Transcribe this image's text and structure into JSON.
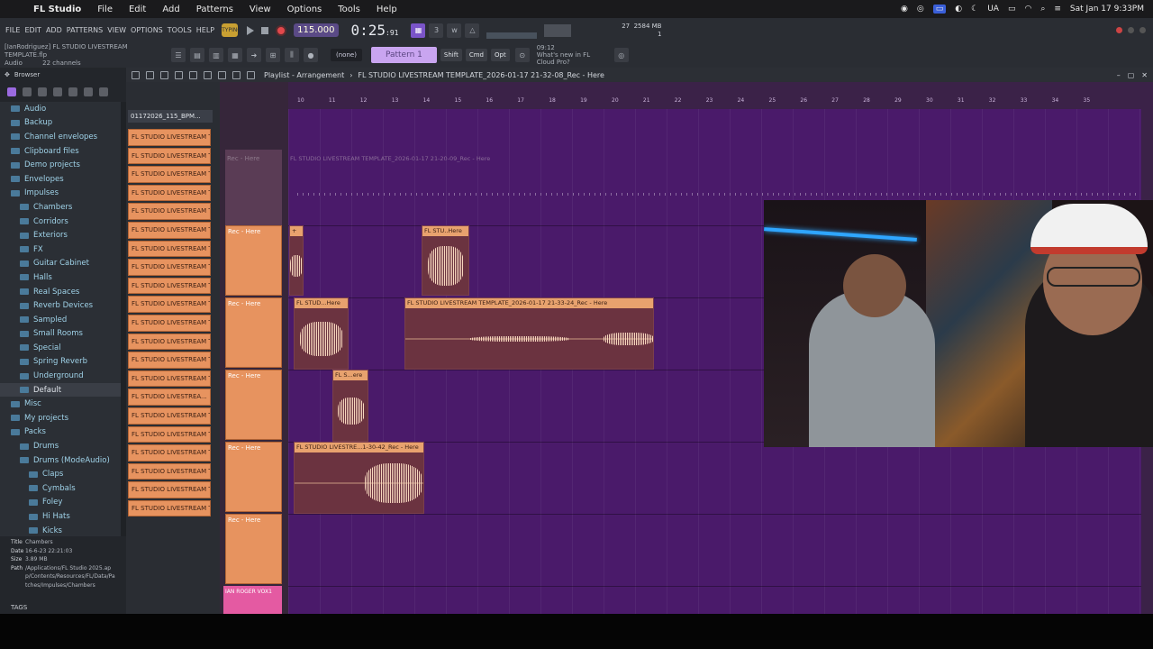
{
  "menubar": {
    "app": "FL Studio",
    "items": [
      "File",
      "Edit",
      "Add",
      "Patterns",
      "View",
      "Options",
      "Tools",
      "Help"
    ],
    "status": [
      "UA"
    ],
    "datetime": "Sat Jan 17  9:33PM"
  },
  "toolbar": {
    "fl_menu": [
      "FILE",
      "EDIT",
      "ADD",
      "PATTERNS",
      "VIEW",
      "OPTIONS",
      "TOOLS",
      "HELP"
    ],
    "hint": "TYPING",
    "tempo": "115.000",
    "time_main": "0:25",
    "time_sub": ":91",
    "cpu_top": "27",
    "mem": "2584 MB",
    "voices": "1"
  },
  "toolbar2": {
    "path_line1": "[IanRodriguez] FL STUDIO LIVESTREAM TEMPLATE.flp",
    "path_line2": "Audio",
    "channels": "22 channels",
    "snap": "(none)",
    "pattern": "Pattern 1",
    "keys": [
      "Shift",
      "Cmd",
      "Opt"
    ],
    "news_time": "09:12",
    "news_text": "What's new in FL Cloud Pro?"
  },
  "browser": {
    "title": "Browser",
    "items": [
      {
        "label": "Audio",
        "level": 0
      },
      {
        "label": "Backup",
        "level": 0
      },
      {
        "label": "Channel envelopes",
        "level": 0
      },
      {
        "label": "Clipboard files",
        "level": 0
      },
      {
        "label": "Demo projects",
        "level": 0
      },
      {
        "label": "Envelopes",
        "level": 0
      },
      {
        "label": "Impulses",
        "level": 0
      },
      {
        "label": "Chambers",
        "level": 1
      },
      {
        "label": "Corridors",
        "level": 1
      },
      {
        "label": "Exteriors",
        "level": 1
      },
      {
        "label": "FX",
        "level": 1
      },
      {
        "label": "Guitar Cabinet",
        "level": 1
      },
      {
        "label": "Halls",
        "level": 1
      },
      {
        "label": "Real Spaces",
        "level": 1
      },
      {
        "label": "Reverb Devices",
        "level": 1
      },
      {
        "label": "Sampled",
        "level": 1
      },
      {
        "label": "Small Rooms",
        "level": 1
      },
      {
        "label": "Special",
        "level": 1
      },
      {
        "label": "Spring Reverb",
        "level": 1
      },
      {
        "label": "Underground",
        "level": 1
      },
      {
        "label": "Default",
        "level": 1,
        "selected": true
      },
      {
        "label": "Misc",
        "level": 0
      },
      {
        "label": "My projects",
        "level": 0
      },
      {
        "label": "Packs",
        "level": 0
      },
      {
        "label": "Drums",
        "level": 1
      },
      {
        "label": "Drums (ModeAudio)",
        "level": 1
      },
      {
        "label": "Claps",
        "level": 2
      },
      {
        "label": "Cymbals",
        "level": 2
      },
      {
        "label": "Foley",
        "level": 2
      },
      {
        "label": "Hi Hats",
        "level": 2
      },
      {
        "label": "Kicks",
        "level": 2
      }
    ],
    "fileinfo": {
      "title_k": "Title",
      "title_v": "Chambers",
      "date_k": "Date",
      "date_v": "16-6-23 22:21:03",
      "size_k": "Size",
      "size_v": "3.89 MB",
      "path_k": "Path",
      "path_v": "/Applications/FL Studio 2025.app/Contents/Resources/FL/Data/Patches/Impulses/Chambers"
    },
    "tags": "TAGS"
  },
  "channels": {
    "selected": "01172026_115_BPM...",
    "items": [
      "FL STUDIO LIVESTREAM T...",
      "FL STUDIO LIVESTREAM T...",
      "FL STUDIO LIVESTREAM T...",
      "FL STUDIO LIVESTREAM T...",
      "FL STUDIO LIVESTREAM T...",
      "FL STUDIO LIVESTREAM T...",
      "FL STUDIO LIVESTREAM T...",
      "FL STUDIO LIVESTREAM T...",
      "FL STUDIO LIVESTREAM T...",
      "FL STUDIO LIVESTREAM T...",
      "FL STUDIO LIVESTREAM T...",
      "FL STUDIO LIVESTREAM T...",
      "FL STUDIO LIVESTREAM T...",
      "FL STUDIO LIVESTREAM T...",
      "FL STUDIO LIVESTREA...",
      "FL STUDIO LIVESTREAM T...",
      "FL STUDIO LIVESTREAM T...",
      "FL STUDIO LIVESTREAM T...",
      "FL STUDIO LIVESTREAM T...",
      "FL STUDIO LIVESTREAM T...",
      "FL STUDIO LIVESTREAM T..."
    ]
  },
  "playlist": {
    "title": "Playlist - Arrangement",
    "project": "FL STUDIO LIVESTREAM TEMPLATE_2026-01-17 21-32-08_Rec - Here",
    "ruler": [
      "10",
      "11",
      "12",
      "13",
      "14",
      "15",
      "16",
      "17",
      "18",
      "19",
      "20",
      "21",
      "22",
      "23",
      "24",
      "25",
      "26",
      "27",
      "28",
      "29",
      "30",
      "31",
      "32",
      "33",
      "34",
      "35"
    ],
    "ghost_track": "Rec - Here",
    "ghost_clip": "FL STUDIO LIVESTREAM TEMPLATE_2026-01-17 21-20-09_Rec - Here",
    "track_label": "Rec - Here",
    "vox_track": "IAN ROGER VOX1",
    "clips": {
      "c1": "FL STU..Here",
      "c2": "FL STUD...Here",
      "c3": "FL STUDIO LIVESTREAM TEMPLATE_2026-01-17 21-33-24_Rec - Here",
      "c4": "FL S...ere",
      "c5": "FL STUDIO LIVESTRE...1-30-42_Rec - Here"
    }
  },
  "colors": {
    "accent": "#7a54c8",
    "clip": "#e7935f",
    "playlist_bg": "#4a1a6a",
    "record": "#e2484c"
  }
}
